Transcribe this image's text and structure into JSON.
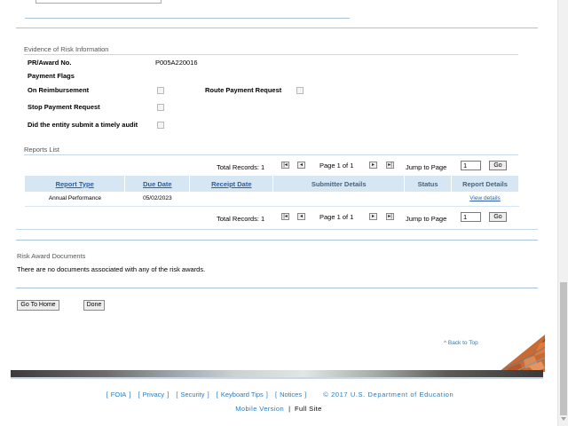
{
  "risk": {
    "section_title": "Evidence of Risk Information",
    "pr_award_label": "PR/Award No.",
    "pr_award_value": "P005A220016",
    "payment_flags_label": "Payment Flags",
    "on_reimbursement_label": "On Reimbursement",
    "route_payment_label": "Route Payment Request",
    "stop_payment_label": "Stop Payment Request",
    "timely_audit_label": "Did the entity submit a timely audit"
  },
  "reports": {
    "section_title": "Reports List",
    "pager": {
      "total_records": "Total Records: 1",
      "page_label": "Page 1 of 1",
      "jump_label": "Jump to Page",
      "jump_value": "1",
      "go_label": "Go"
    },
    "columns": [
      "Report Type",
      "Due Date",
      "Receipt Date",
      "Submitter Details",
      "Status",
      "Report Details"
    ],
    "rows": [
      {
        "report_type": "Annual Performance",
        "due_date": "05/02/2023",
        "receipt_date": "",
        "submitter_details": "",
        "status": "",
        "report_details": "View details"
      }
    ]
  },
  "documents": {
    "section_title": "Risk Award Documents",
    "empty_message": "There are no documents associated with any of the risk awards."
  },
  "actions": {
    "home_label": "Go To Home",
    "done_label": "Done"
  },
  "back_to_top": "^ Back to Top",
  "footer": {
    "links": [
      "FOIA",
      "Privacy",
      "Security",
      "Keyboard Tips",
      "Notices"
    ],
    "copyright": "© 2017 U.S. Department of Education",
    "mobile_label": "Mobile Version",
    "full_label": "Full Site"
  },
  "icons": {
    "first_page": "first-page-icon",
    "prev_page": "prev-page-icon",
    "next_page": "next-page-icon",
    "last_page": "last-page-icon"
  },
  "colors": {
    "link": "#2a5ea8",
    "header_bg": "#d6e6f3",
    "rule": "#a8c4d8"
  }
}
